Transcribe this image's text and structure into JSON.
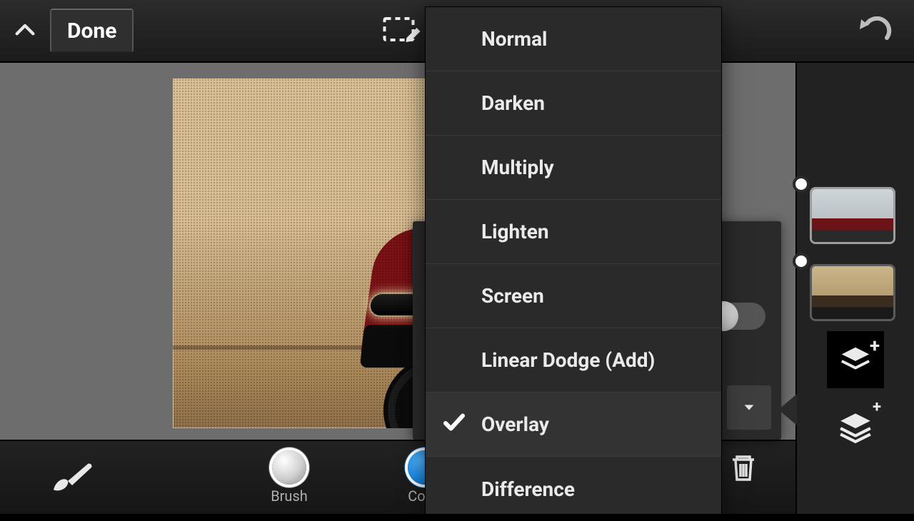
{
  "topbar": {
    "done": "Done"
  },
  "blend_modes": {
    "items": [
      {
        "label": "Normal",
        "selected": false
      },
      {
        "label": "Darken",
        "selected": false
      },
      {
        "label": "Multiply",
        "selected": false
      },
      {
        "label": "Lighten",
        "selected": false
      },
      {
        "label": "Screen",
        "selected": false
      },
      {
        "label": "Linear Dodge (Add)",
        "selected": false
      },
      {
        "label": "Overlay",
        "selected": true
      },
      {
        "label": "Difference",
        "selected": false
      }
    ]
  },
  "bottombar": {
    "brush": "Brush",
    "color": "Color"
  }
}
